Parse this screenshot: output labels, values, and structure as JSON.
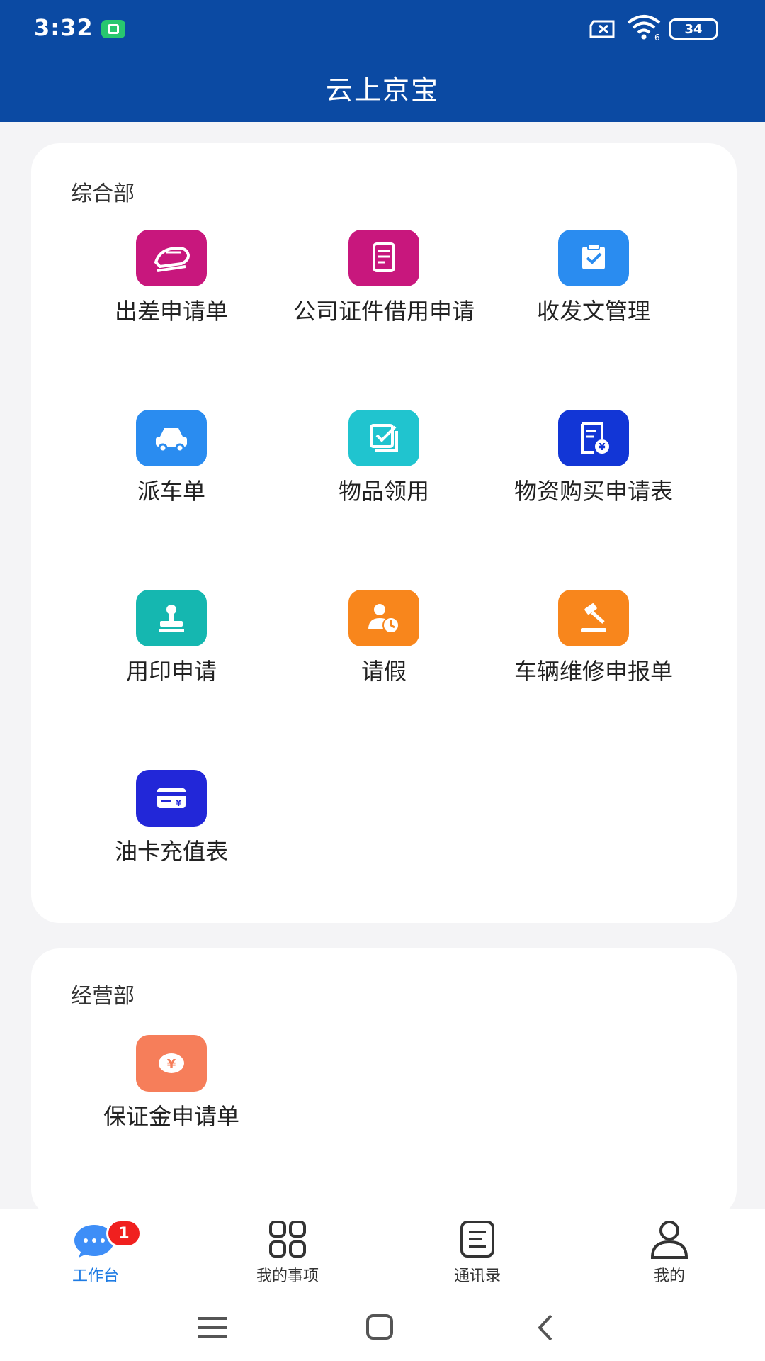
{
  "status_bar": {
    "time": "3:32",
    "battery": "34",
    "wifi_sub": "6"
  },
  "header": {
    "title": "云上京宝"
  },
  "sections": [
    {
      "title": "综合部",
      "items": [
        {
          "label": "出差申请单",
          "icon": "train-icon",
          "color": "#c8177d"
        },
        {
          "label": "公司证件借用申请",
          "icon": "document-icon",
          "color": "#c8177d"
        },
        {
          "label": "收发文管理",
          "icon": "clipboard-check-icon",
          "color": "#2a8cf0"
        },
        {
          "label": "派车单",
          "icon": "car-icon",
          "color": "#2a8cf0"
        },
        {
          "label": "物品领用",
          "icon": "checkbox-icon",
          "color": "#20c4cf"
        },
        {
          "label": "物资购买申请表",
          "icon": "receipt-yuan-icon",
          "color": "#1236d6"
        },
        {
          "label": "用印申请",
          "icon": "stamp-icon",
          "color": "#15b7b0"
        },
        {
          "label": "请假",
          "icon": "user-clock-icon",
          "color": "#f8861c"
        },
        {
          "label": "车辆维修申报单",
          "icon": "gavel-icon",
          "color": "#f8861c"
        },
        {
          "label": "油卡充值表",
          "icon": "card-yuan-icon",
          "color": "#2227d8"
        }
      ]
    },
    {
      "title": "经营部",
      "items": [
        {
          "label": "保证金申请单",
          "icon": "coin-yuan-icon",
          "color": "#f67e5a"
        }
      ]
    }
  ],
  "bottom_nav": [
    {
      "label": "工作台",
      "icon": "chat-bubble-icon",
      "active": true,
      "badge": "1"
    },
    {
      "label": "我的事项",
      "icon": "grid-icon",
      "active": false
    },
    {
      "label": "通讯录",
      "icon": "contacts-list-icon",
      "active": false
    },
    {
      "label": "我的",
      "icon": "person-icon",
      "active": false
    }
  ],
  "colors": {
    "header": "#0b4aa3",
    "active_nav": "#1e7be3",
    "badge": "#f0201f"
  }
}
